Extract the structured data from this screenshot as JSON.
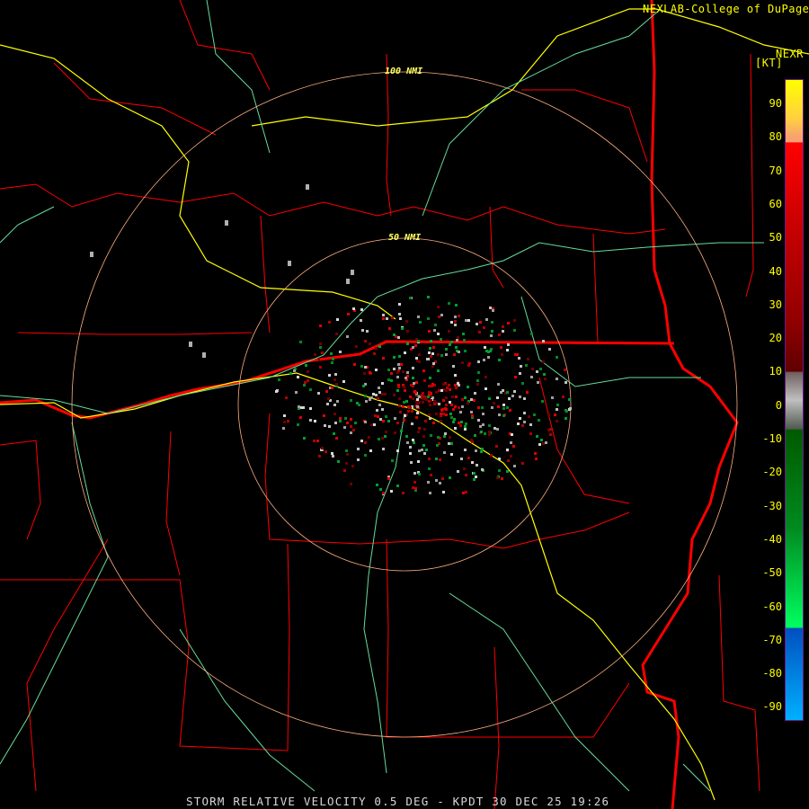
{
  "header": {
    "credit": "NEXLAB-College of DuPage",
    "product": "NEXR",
    "units": "[KT]"
  },
  "rings": [
    {
      "label": "50 NMI"
    },
    {
      "label": "100 NMI"
    }
  ],
  "legend": {
    "ticks": [
      "90",
      "80",
      "70",
      "60",
      "50",
      "40",
      "30",
      "20",
      "10",
      "0",
      "-10",
      "-20",
      "-30",
      "-40",
      "-50",
      "-60",
      "-70",
      "-80",
      "-90"
    ],
    "colors": {
      "high": "#ffff00",
      "inbound_strong": "#ff0000",
      "near_zero": "#c0c0c0",
      "outbound": "#00ff60",
      "outbound_extreme": "#00b0ff"
    }
  },
  "caption": "STORM RELATIVE VELOCITY 0.5 DEG - KPDT 30 DEC 25 19:26",
  "map_colors": {
    "county_lines": "#ff0000",
    "state_lines": "#ff0000",
    "highways": "#ffff00",
    "rivers": "#66dd99",
    "range_rings": "#ffb080"
  }
}
